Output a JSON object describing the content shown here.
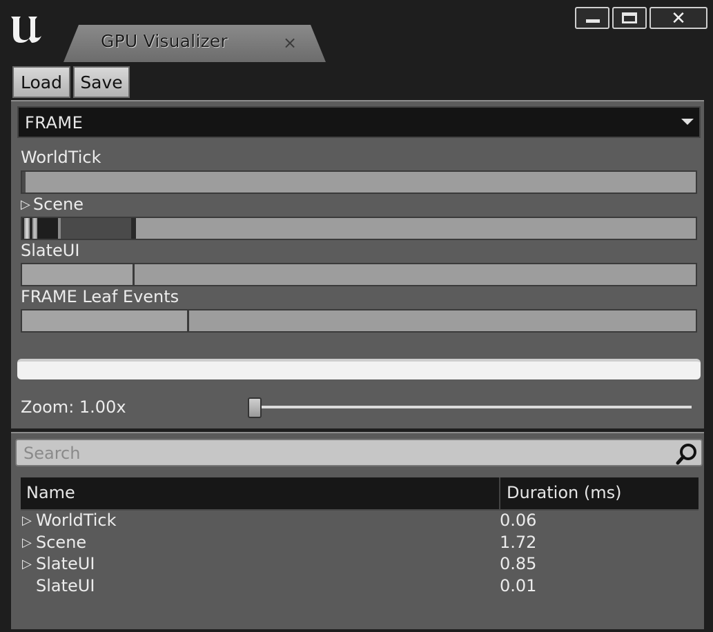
{
  "window": {
    "tab_title": "GPU Visualizer",
    "tab_close_glyph": "×",
    "close_glyph": "✕",
    "logo_icon": "unreal-engine-logo-icon"
  },
  "toolbar": {
    "load_label": "Load",
    "save_label": "Save"
  },
  "frame_selector": {
    "selected": "FRAME"
  },
  "timeline": {
    "rows": [
      {
        "label": "WorldTick",
        "expandable": false
      },
      {
        "label": "Scene",
        "expandable": true
      },
      {
        "label": "SlateUI",
        "expandable": false
      },
      {
        "label": "FRAME Leaf Events",
        "expandable": false
      }
    ]
  },
  "zoom": {
    "label": "Zoom: 1.00x",
    "value": 1.0
  },
  "search": {
    "placeholder": "Search",
    "value": ""
  },
  "table": {
    "columns": [
      "Name",
      "Duration (ms)"
    ],
    "rows": [
      {
        "name": "WorldTick",
        "duration": "0.06",
        "expandable": true
      },
      {
        "name": "Scene",
        "duration": "1.72",
        "expandable": true
      },
      {
        "name": "SlateUI",
        "duration": "0.85",
        "expandable": true
      },
      {
        "name": "SlateUI",
        "duration": "0.01",
        "expandable": false
      }
    ]
  },
  "icons": {
    "expand": "▷",
    "search": "magnifier-icon"
  },
  "colors": {
    "background": "#1e1e1e",
    "panel": "#5c5c5c",
    "bar": "#9d9d9d",
    "timeline": "#f2f2f2"
  }
}
